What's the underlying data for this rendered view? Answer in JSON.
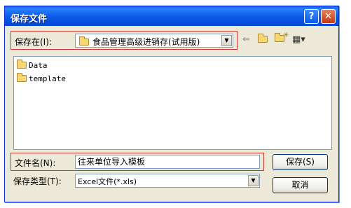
{
  "window": {
    "title": "保存文件"
  },
  "title_buttons": {
    "help_glyph": "?",
    "close_glyph": "✕"
  },
  "location": {
    "label": "保存在(I):",
    "value": "食品管理高级进销存(试用版)"
  },
  "toolbar": {
    "back_icon": "back-arrow-icon",
    "up_icon": "up-folder-icon",
    "new_folder_icon": "new-folder-icon",
    "views_icon": "views-menu-icon"
  },
  "files": [
    {
      "name": "Data"
    },
    {
      "name": "template"
    }
  ],
  "filename": {
    "label": "文件名(N):",
    "value": "往来单位导入模板"
  },
  "filetype": {
    "label": "保存类型(T):",
    "value": "Excel文件(*.xls)"
  },
  "buttons": {
    "save": "保存(S)",
    "cancel": "取消"
  },
  "colors": {
    "title_bar": "#0A59E7",
    "dialog_bg": "#ECE9D8",
    "highlight_box": "#CC3333",
    "folder": "#F7D774"
  }
}
